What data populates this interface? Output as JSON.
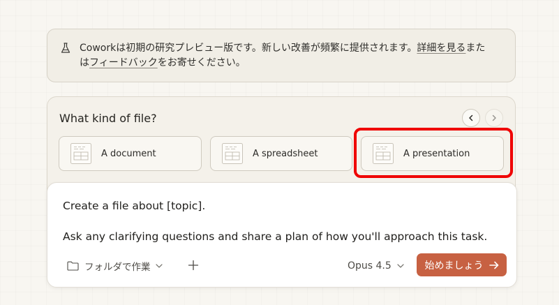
{
  "notice": {
    "text_1": "Coworkは初期の研究プレビュー版です。新しい改善が頻繁に提供されます。",
    "link_details": "詳細を見る",
    "text_2": "また",
    "text_3": "は",
    "link_feedback": "フィードバック",
    "text_4": "をお寄せください。"
  },
  "file_kind": {
    "title": "What kind of file?",
    "options": [
      {
        "label": "A document"
      },
      {
        "label": "A spreadsheet"
      },
      {
        "label": "A presentation"
      }
    ]
  },
  "prompt": {
    "line1": "Create a file about [topic].",
    "line2": "Ask any clarifying questions and share a plan of how you'll approach this task.",
    "folder_label": "フォルダで作業",
    "model_label": "Opus 4.5",
    "start_label": "始めましょう"
  },
  "colors": {
    "accent": "#c76142",
    "highlight": "#ef0000",
    "background": "#f8f6f1"
  },
  "icons": [
    "flask-icon",
    "chevron-left-icon",
    "chevron-right-icon",
    "file-icon",
    "folder-icon",
    "chevron-down-icon",
    "plus-icon",
    "arrow-right-icon"
  ]
}
